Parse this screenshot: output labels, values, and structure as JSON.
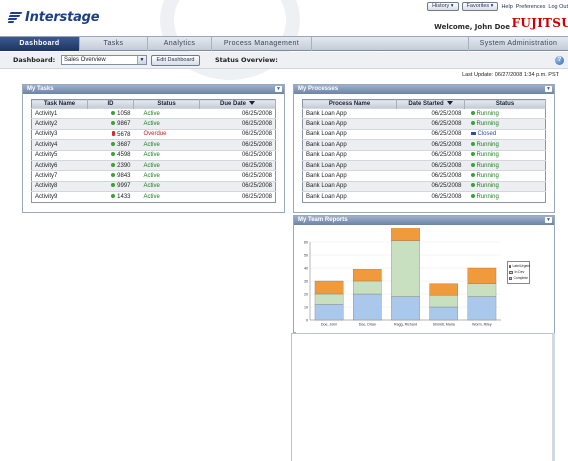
{
  "app": {
    "brand": "Interstage",
    "vendor": "FUJITSU",
    "welcome": "Welcome, John Doe"
  },
  "top_links": {
    "history": "History ▾",
    "favorites": "Favorites ▾",
    "help": "Help",
    "preferences": "Preferences",
    "logout": "Log Out"
  },
  "nav": {
    "tabs": [
      {
        "label": "Dashboard",
        "active": true
      },
      {
        "label": "Tasks",
        "active": false
      },
      {
        "label": "Analytics",
        "active": false
      },
      {
        "label": "Process Management",
        "active": false
      },
      {
        "label": "System Administration",
        "active": false
      }
    ]
  },
  "toolbar": {
    "dashboard_label": "Dashboard:",
    "dashboard_value": "Sales Overview",
    "edit_button": "Edit Dashboard",
    "status_label": "Status Overview:"
  },
  "last_update": "Last Update: 06/27/2008 1:34 p.m. PST",
  "my_tasks": {
    "title": "My Tasks",
    "columns": [
      "Task Name",
      "ID",
      "Status",
      "Due Date"
    ],
    "rows": [
      {
        "name": "Activity1",
        "id": "1058",
        "status": "Active",
        "due": "06/25/2008",
        "state": "ok"
      },
      {
        "name": "Activity2",
        "id": "9867",
        "status": "Active",
        "due": "06/25/2008",
        "state": "ok"
      },
      {
        "name": "Activity3",
        "id": "5678",
        "status": "Overdue",
        "due": "06/25/2008",
        "state": "overdue"
      },
      {
        "name": "Activity4",
        "id": "3687",
        "status": "Active",
        "due": "06/25/2008",
        "state": "ok"
      },
      {
        "name": "Activity5",
        "id": "4598",
        "status": "Active",
        "due": "06/25/2008",
        "state": "ok"
      },
      {
        "name": "Activity6",
        "id": "2390",
        "status": "Active",
        "due": "06/25/2008",
        "state": "ok"
      },
      {
        "name": "Activity7",
        "id": "9843",
        "status": "Active",
        "due": "06/25/2008",
        "state": "ok"
      },
      {
        "name": "Activity8",
        "id": "9997",
        "status": "Active",
        "due": "06/25/2008",
        "state": "ok"
      },
      {
        "name": "Activity9",
        "id": "1433",
        "status": "Active",
        "due": "06/25/2008",
        "state": "ok"
      }
    ]
  },
  "my_processes": {
    "title": "My Processes",
    "columns": [
      "Process Name",
      "Date Started",
      "Status"
    ],
    "rows": [
      {
        "name": "Bank Loan App",
        "date": "06/25/2008",
        "status": "Running",
        "state": "ok"
      },
      {
        "name": "Bank Loan App",
        "date": "06/25/2008",
        "status": "Running",
        "state": "ok"
      },
      {
        "name": "Bank Loan App",
        "date": "06/25/2008",
        "status": "Closed",
        "state": "closed"
      },
      {
        "name": "Bank Loan App",
        "date": "06/25/2008",
        "status": "Running",
        "state": "ok"
      },
      {
        "name": "Bank Loan App",
        "date": "06/25/2008",
        "status": "Running",
        "state": "ok"
      },
      {
        "name": "Bank Loan App",
        "date": "06/25/2008",
        "status": "Running",
        "state": "ok"
      },
      {
        "name": "Bank Loan App",
        "date": "06/25/2008",
        "status": "Running",
        "state": "ok"
      },
      {
        "name": "Bank Loan App",
        "date": "06/25/2008",
        "status": "Running",
        "state": "ok"
      },
      {
        "name": "Bank Loan App",
        "date": "06/25/2008",
        "status": "Running",
        "state": "ok"
      }
    ]
  },
  "team_reports": {
    "title": "My Team Reports"
  },
  "chart_data": {
    "type": "bar",
    "stacked": true,
    "categories": [
      "Doe, John",
      "Doe, Drian",
      "Ragg, Richard",
      "Shmidt, Maria",
      "Worm, Riley"
    ],
    "series": [
      {
        "name": "Complete",
        "values": [
          12,
          20,
          18,
          10,
          18
        ],
        "color": "#a9c8ec"
      },
      {
        "name": "In Dev",
        "values": [
          8,
          10,
          43,
          9,
          10
        ],
        "color": "#c9e0c0"
      },
      {
        "name": "Late/Urgent",
        "values": [
          10,
          9,
          11,
          9,
          12
        ],
        "color": "#f09a3b"
      }
    ],
    "ylim": [
      0,
      60
    ],
    "yticks": [
      0,
      10,
      20,
      30,
      40,
      50,
      60
    ],
    "grid": true,
    "legend": "right"
  },
  "colors": {
    "nav_active": "#1b3462",
    "panel_header": "#6b83a6",
    "status_active": "#1f7d1f",
    "status_overdue": "#c81e1e"
  }
}
